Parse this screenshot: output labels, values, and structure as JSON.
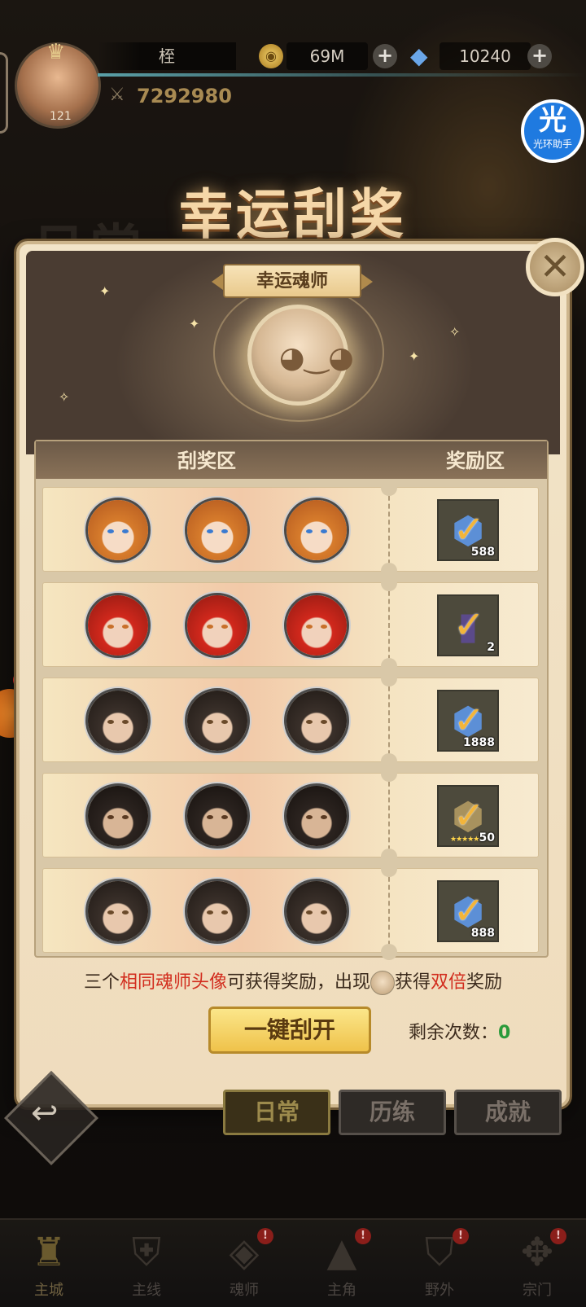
{
  "hud": {
    "player_name": "桎",
    "player_level": "121",
    "gold": "69M",
    "diamonds": "10240",
    "power": "7292980",
    "assistant_char": "光",
    "assistant_label": "光环助手"
  },
  "background_label": "日常",
  "title": "幸运刮奖",
  "modal": {
    "subtitle": "幸运魂师",
    "close_glyph": "✕",
    "headers": {
      "scratch_zone": "刮奖区",
      "reward_zone": "奖励区"
    },
    "rows": [
      {
        "hair": "orange",
        "reward_icon": "blue-gem-icon",
        "reward_qty": "588"
      },
      {
        "hair": "red",
        "reward_icon": "purple-card-icon",
        "reward_qty": "2"
      },
      {
        "hair": "dark",
        "reward_icon": "blue-gem-icon",
        "reward_qty": "1888"
      },
      {
        "hair": "dark2",
        "reward_icon": "gold-shard-icon",
        "reward_qty": "50",
        "reward_stars": "★★★★★"
      },
      {
        "hair": "dark",
        "reward_icon": "blue-gem-icon",
        "reward_qty": "888"
      }
    ],
    "hint": {
      "part1": "三个",
      "highlight1": "相同魂师头像",
      "part2": "可获得奖励，出现",
      "part3": "获得",
      "highlight2": "双倍",
      "part4": "奖励"
    },
    "scratch_button": "一键刮开",
    "remaining_label": "剩余次数：",
    "remaining_value": "0"
  },
  "tabs": [
    {
      "label": "日常",
      "active": true
    },
    {
      "label": "历练",
      "active": false
    },
    {
      "label": "成就",
      "active": false
    }
  ],
  "nav": [
    {
      "label": "主城",
      "icon": "castle-icon",
      "active": true,
      "badge": ""
    },
    {
      "label": "主线",
      "icon": "shield-icon",
      "active": false,
      "badge": ""
    },
    {
      "label": "魂师",
      "icon": "diamond-emblem-icon",
      "active": false,
      "badge": "!"
    },
    {
      "label": "主角",
      "icon": "hood-icon",
      "active": false,
      "badge": "!"
    },
    {
      "label": "野外",
      "icon": "field-shield-icon",
      "active": false,
      "badge": "!"
    },
    {
      "label": "宗门",
      "icon": "wings-emblem-icon",
      "active": false,
      "badge": "!"
    }
  ],
  "colors": {
    "accent_gold": "#efc24a",
    "highlight_red": "#d22d1e",
    "remaining_green": "#2a9a3a",
    "assistant_blue": "#1f7ae0"
  }
}
